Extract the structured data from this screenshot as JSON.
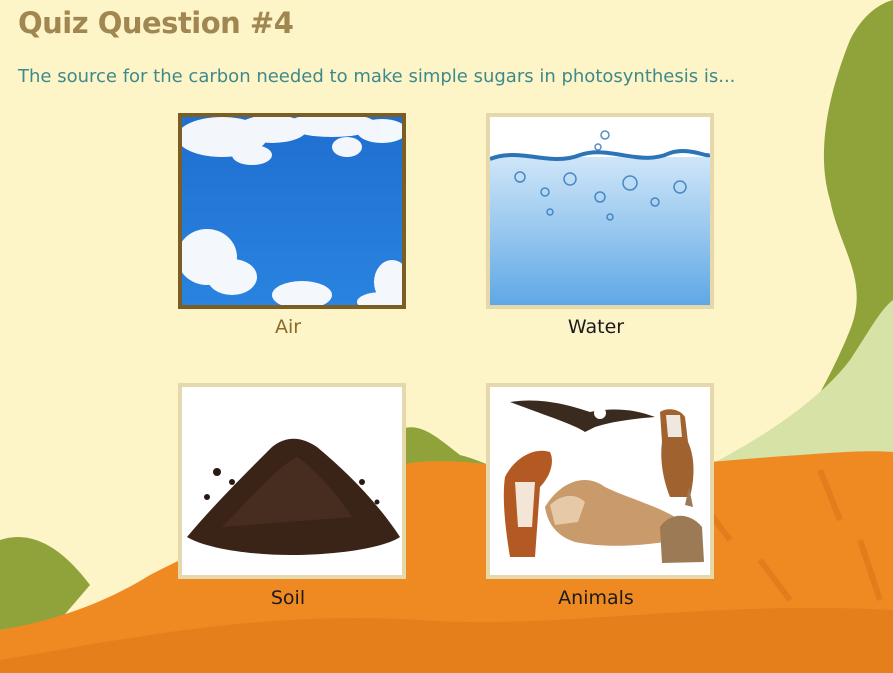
{
  "title": "Quiz Question #4",
  "question": "The source for the carbon needed to make simple sugars in photosynthesis is...",
  "choices": [
    {
      "label": "Air",
      "icon": "sky-clouds-image",
      "selected": true
    },
    {
      "label": "Water",
      "icon": "water-splash-image",
      "selected": false
    },
    {
      "label": "Soil",
      "icon": "soil-pile-image",
      "selected": false
    },
    {
      "label": "Animals",
      "icon": "animals-image",
      "selected": false
    }
  ],
  "colors": {
    "background": "#fdf4c8",
    "title": "#a08650",
    "question": "#3e8a8a",
    "selected_border": "#7b5d26",
    "card_border": "#e6d8ad",
    "hill_orange": "#ef8a22",
    "hill_green": "#8fa33a"
  }
}
